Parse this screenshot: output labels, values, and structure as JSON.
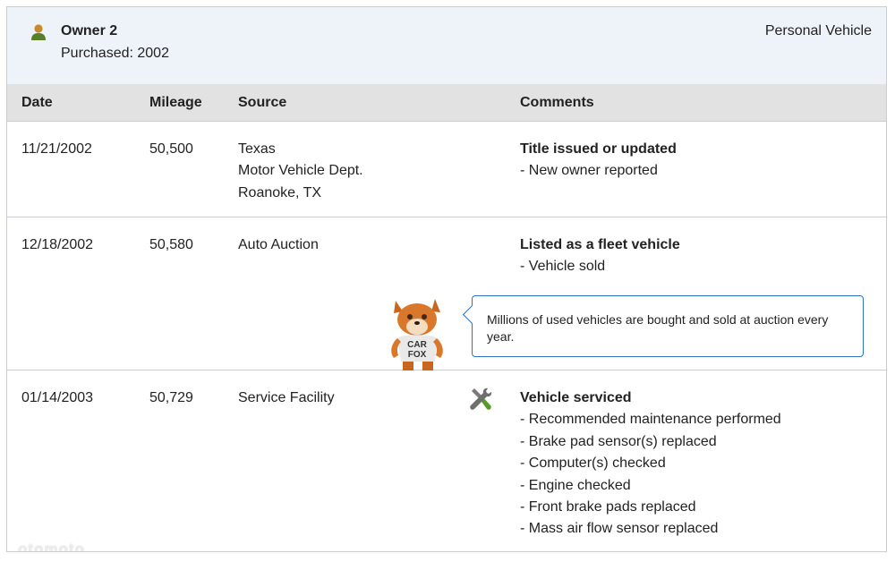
{
  "owner": {
    "title": "Owner 2",
    "purchased": "Purchased: 2002",
    "vehicle_type": "Personal Vehicle",
    "icon": "person-icon",
    "icon_color": "#5a7f2a"
  },
  "columns": [
    "Date",
    "Mileage",
    "Source",
    "Comments"
  ],
  "rows": [
    {
      "date": "11/21/2002",
      "mileage": "50,500",
      "source": [
        "Texas",
        "Motor Vehicle Dept.",
        "Roanoke, TX"
      ],
      "comment_title": "Title issued or updated",
      "comments": [
        "- New owner reported"
      ]
    },
    {
      "date": "12/18/2002",
      "mileage": "50,580",
      "source": [
        "Auto Auction"
      ],
      "comment_title": "Listed as a fleet vehicle",
      "comments": [
        "- Vehicle sold"
      ]
    },
    {
      "date": "01/14/2003",
      "mileage": "50,729",
      "source": [
        "Service Facility"
      ],
      "comment_title": "Vehicle serviced",
      "comments": [
        "- Recommended maintenance performed",
        "- Brake pad sensor(s) replaced",
        "- Computer(s) checked",
        "- Engine checked",
        "- Front brake pads replaced",
        "- Mass air flow sensor replaced"
      ],
      "icon": "wrench-screwdriver-icon"
    }
  ],
  "tip": {
    "text": "Millions of used vehicles are bought and sold at auction every year.",
    "mascot": "carfox-mascot-icon",
    "mascot_shirt": [
      "CAR",
      "FOX"
    ],
    "border_color": "#2b73c4"
  },
  "watermark": "otomoto"
}
